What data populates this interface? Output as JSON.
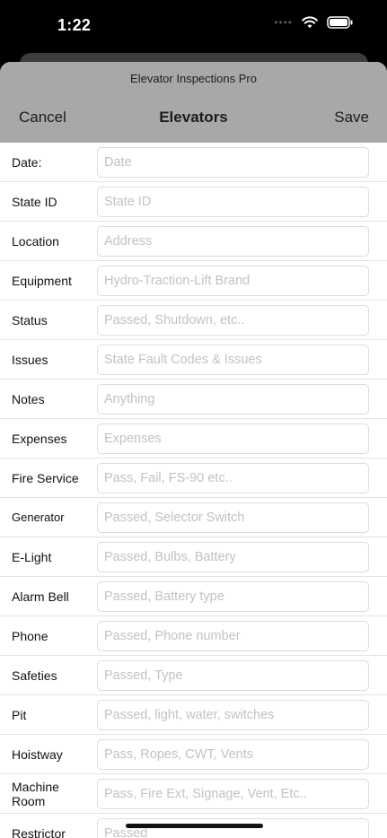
{
  "status_bar": {
    "time": "1:22",
    "icons": [
      "signal-dots-icon",
      "wifi-icon",
      "battery-icon"
    ]
  },
  "nav": {
    "app_title": "Elevator Inspections Pro",
    "cancel_label": "Cancel",
    "title": "Elevators",
    "save_label": "Save"
  },
  "form": {
    "rows": [
      {
        "label": "Date:",
        "placeholder": "Date"
      },
      {
        "label": "State ID",
        "placeholder": "State ID"
      },
      {
        "label": "Location",
        "placeholder": "Address"
      },
      {
        "label": "Equipment",
        "placeholder": "Hydro-Traction-Lift Brand"
      },
      {
        "label": "Status",
        "placeholder": "Passed, Shutdown, etc.."
      },
      {
        "label": "Issues",
        "placeholder": "State Fault Codes & Issues"
      },
      {
        "label": "Notes",
        "placeholder": "Anything"
      },
      {
        "label": "Expenses",
        "placeholder": "Expenses"
      },
      {
        "label": "Fire Service",
        "placeholder": "Pass, Fail, FS-90 etc.."
      },
      {
        "label": "Generator",
        "placeholder": "Passed, Selector Switch"
      },
      {
        "label": "E-Light",
        "placeholder": "Passed, Bulbs, Battery"
      },
      {
        "label": "Alarm Bell",
        "placeholder": "Passed, Battery type"
      },
      {
        "label": "Phone",
        "placeholder": "Passed, Phone number"
      },
      {
        "label": "Safeties",
        "placeholder": "Passed, Type"
      },
      {
        "label": "Pit",
        "placeholder": "Passed, light, water, switches"
      },
      {
        "label": "Hoistway",
        "placeholder": "Pass, Ropes, CWT, Vents"
      },
      {
        "label": "Machine Room",
        "placeholder": "Pass, Fire Ext, Signage, Vent, Etc.."
      },
      {
        "label": "Restrictor",
        "placeholder": "Passed"
      }
    ]
  }
}
